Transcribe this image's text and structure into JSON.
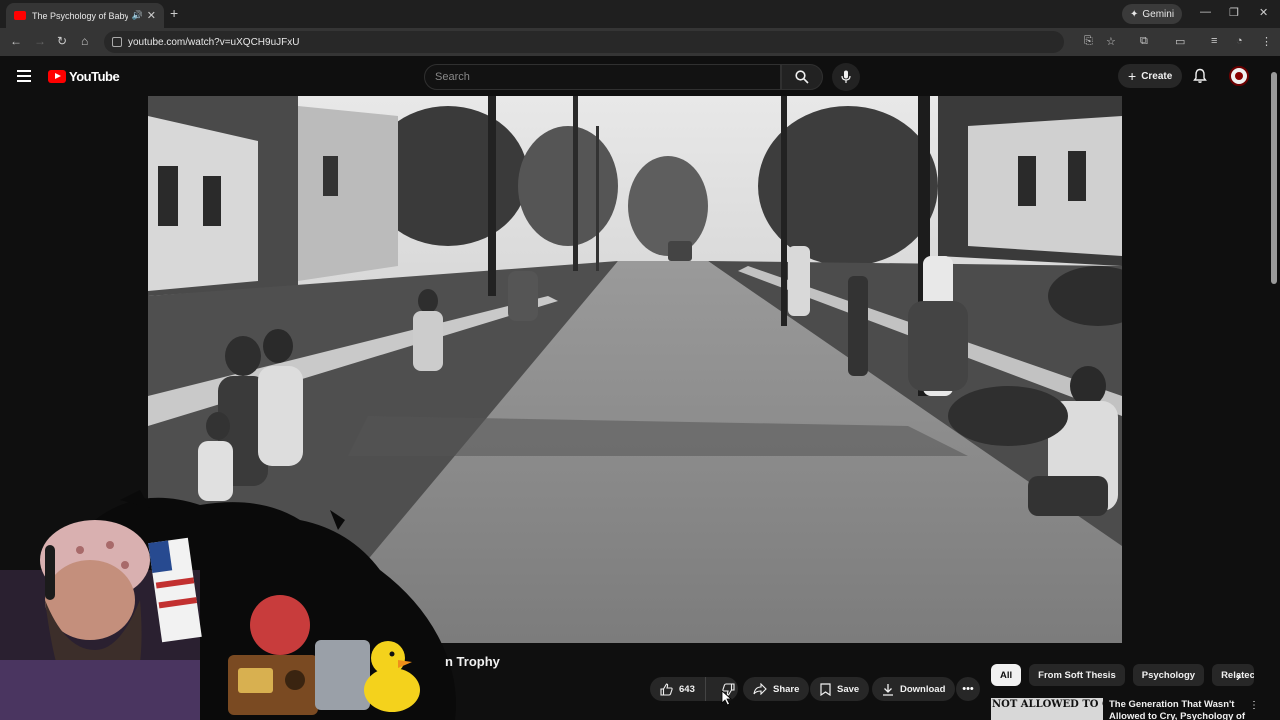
{
  "browser": {
    "tab_title": "The Psychology of Baby Bo",
    "new_tab": "+",
    "gemini_label": "Gemini",
    "url": "youtube.com/watch?v=uXQCH9uJFxU"
  },
  "youtube": {
    "logo_text": "YouTube",
    "search_placeholder": "Search",
    "create_label": "Create"
  },
  "video": {
    "title_fragment": "n Trophy",
    "like_count": "643",
    "share_label": "Share",
    "save_label": "Save",
    "download_label": "Download",
    "more_label": "•••"
  },
  "chips": [
    "All",
    "From Soft Thesis",
    "Psychology",
    "Relatec"
  ],
  "recommendation": {
    "thumb_text": "NOT ALLOWED TO CRY",
    "title": "The Generation That Wasn't Allowed to Cry, Psychology of"
  },
  "colors": {
    "brand_red": "#ff0000",
    "background": "#0f0f0f",
    "chip_bg": "#272727"
  }
}
